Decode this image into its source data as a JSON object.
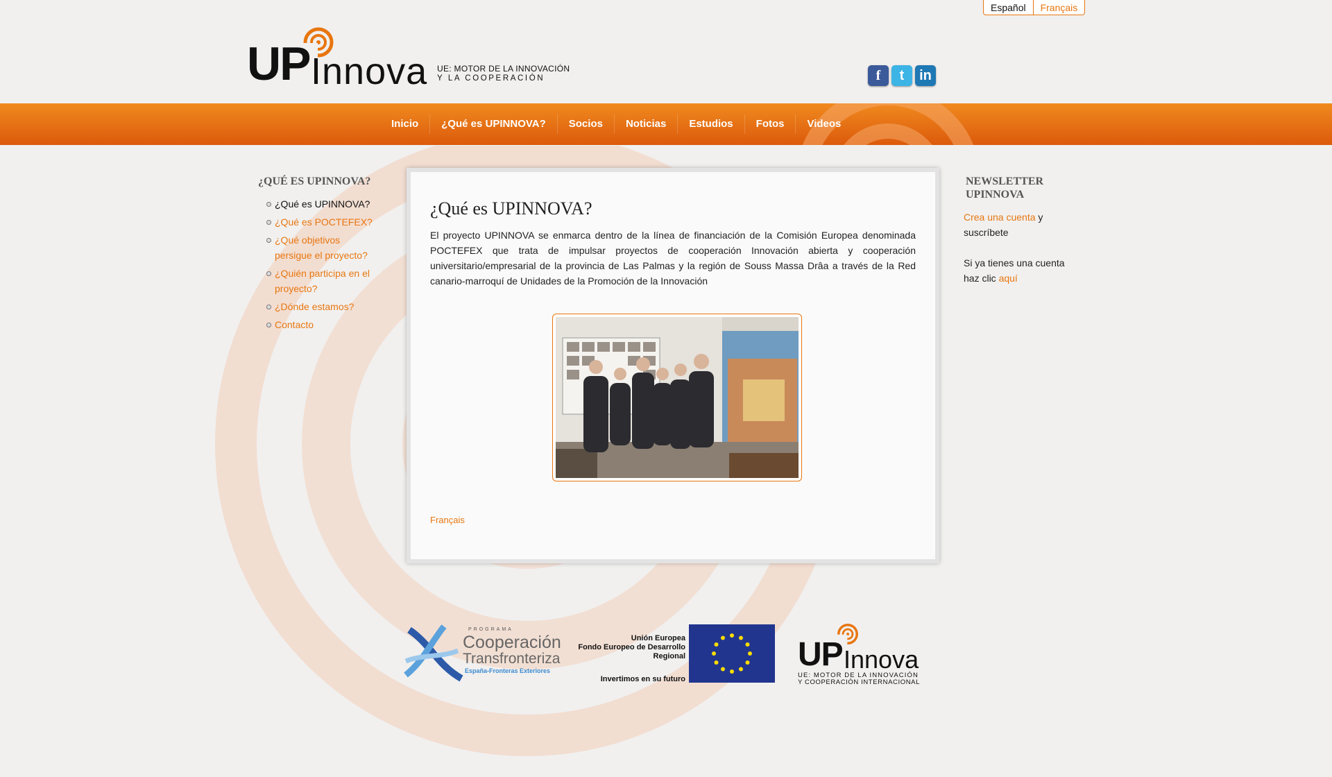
{
  "language_switcher": {
    "es": "Español",
    "fr": "Français"
  },
  "logo": {
    "up": "UP",
    "innova": "Innova",
    "tagline_1": "UE: MOTOR DE LA INNOVACIÓN",
    "tagline_2": "Y LA COOPERACIÓN"
  },
  "social": {
    "facebook": "f",
    "twitter": "t",
    "linkedin": "in"
  },
  "nav": [
    "Inicio",
    "¿Qué es UPINNOVA?",
    "Socios",
    "Noticias",
    "Estudios",
    "Fotos",
    "Videos"
  ],
  "sidebar": {
    "title": "¿Qué es UPINNOVA?",
    "items": [
      "¿Qué es UPINNOVA?",
      "¿Qué es POCTEFEX?",
      "¿Qué objetivos persigue el proyecto?",
      "¿Quién participa en el proyecto?",
      "¿Dónde estamos?",
      "Contacto"
    ]
  },
  "main": {
    "title": "¿Qué es UPINNOVA?",
    "intro": "El proyecto UPINNOVA se enmarca dentro de la línea de financiación de la Comisión Europea denominada POCTEFEX que trata de impulsar proyectos de cooperación Innovación abierta y cooperación universitario/empresarial de la provincia de Las Palmas y la región de Souss Massa Drâa a través de la Red canario-marroquí de Unidades de la Promoción de la Innovación",
    "lang_link": "Français"
  },
  "newsletter": {
    "title": "NEWSLETTER UPINNOVA",
    "create_link": "Crea una cuenta",
    "create_rest": " y suscríbete",
    "login_text": "Si ya tienes una cuenta haz clic ",
    "login_link": "aquí"
  },
  "footer": {
    "ctf_programa": "PROGRAMA",
    "ctf_line1": "Cooperación",
    "ctf_line2": "Transfronteriza",
    "ctf_line3": "España-Fronteras Exteriores",
    "eu_line1": "Unión Europea",
    "eu_line2": "Fondo Europeo de Desarrollo",
    "eu_line3": "Regional",
    "eu_line4": "Invertimos en su futuro",
    "up_logo_1": "UP",
    "up_logo_2": "Innova",
    "up_tag_1": "UE: MOTOR DE LA INNOVACIÓN",
    "up_tag_2": "Y COOPERACIÓN INTERNACIONAL"
  },
  "colors": {
    "accent": "#e8760f",
    "nav_top": "#f08a1e",
    "nav_bottom": "#dc5a0c",
    "eu_blue": "#21358f"
  }
}
